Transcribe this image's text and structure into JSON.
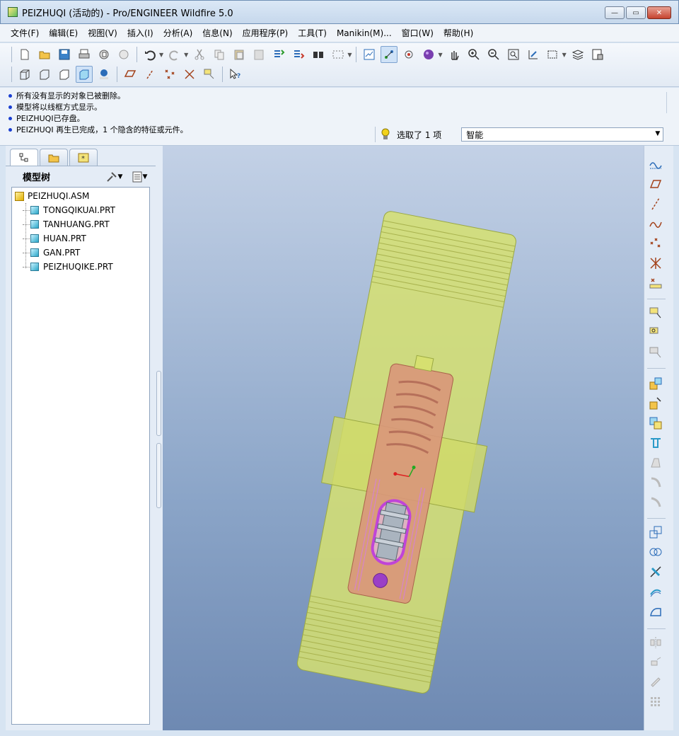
{
  "window": {
    "title": "PEIZHUQI (活动的) - Pro/ENGINEER Wildfire 5.0",
    "buttons": {
      "minimize": "—",
      "maximize": "▭",
      "close": "✕"
    }
  },
  "menu": [
    "文件(F)",
    "编辑(E)",
    "视图(V)",
    "插入(I)",
    "分析(A)",
    "信息(N)",
    "应用程序(P)",
    "工具(T)",
    "Manikin(M)...",
    "窗口(W)",
    "帮助(H)"
  ],
  "messages": [
    "所有没有显示的对象已被删除。",
    "模型将以线框方式显示。",
    "PEIZHUQI已存盘。",
    "PEIZHUQI 再生已完成，1 个隐含的特征或元件。"
  ],
  "selection": {
    "text": "选取了 1 项",
    "filter": "智能"
  },
  "model_tree": {
    "title": "模型树",
    "root": "PEIZHUQI.ASM",
    "children": [
      "TONGQIKUAI.PRT",
      "TANHUANG.PRT",
      "HUAN.PRT",
      "GAN.PRT",
      "PEIZHUQIKE.PRT"
    ]
  },
  "colors": {
    "outer_body": "#d8e07a",
    "inner_body": "#d9a07f",
    "highlight": "#c044d8",
    "viewport_top": "#c3d1e6",
    "viewport_bottom": "#6e89b2"
  }
}
